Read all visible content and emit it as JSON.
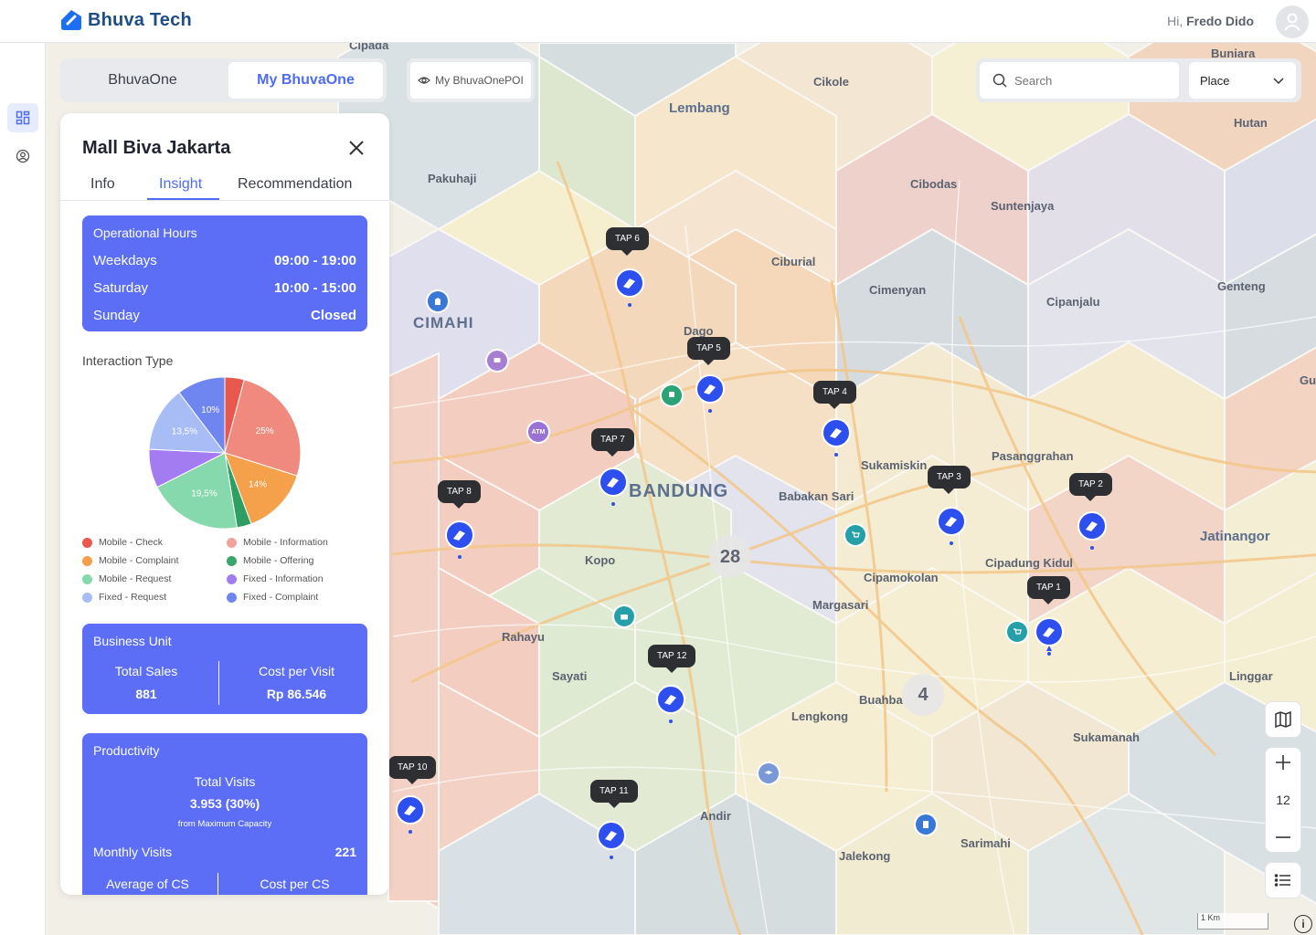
{
  "app": {
    "brand": "Bhuva Tech",
    "greeting_prefix": "Hi,",
    "user_name": "Fredo Dido"
  },
  "toggle": {
    "option_a": "BhuvaOne",
    "option_b": "My BhuvaOne",
    "active": "My BhuvaOne"
  },
  "poi_toggle": {
    "label": "My BhuvaOnePOI"
  },
  "search": {
    "placeholder": "Search",
    "value": "",
    "type_selected": "Place"
  },
  "panel": {
    "title": "Mall Biva Jakarta",
    "tabs": [
      "Info",
      "Insight",
      "Recommendation"
    ],
    "active_tab": "Insight",
    "hours": {
      "title": "Operational Hours",
      "rows": [
        {
          "day": "Weekdays",
          "time": "09:00 - 19:00"
        },
        {
          "day": "Saturday",
          "time": "10:00 - 15:00"
        },
        {
          "day": "Sunday",
          "time": "Closed"
        }
      ]
    },
    "interaction": {
      "title": "Interaction Type",
      "legend": [
        "Mobile - Check",
        "Mobile - Information",
        "Mobile - Complaint",
        "Mobile - Offering",
        "Mobile - Request",
        "Fixed - Information",
        "Fixed - Request",
        "Fixed - Complaint"
      ],
      "legend_colors": [
        "#e8584d",
        "#f0a39d",
        "#f5a04a",
        "#3aa56c",
        "#86d8ad",
        "#a27cf0",
        "#a8bdf6",
        "#6f86f0"
      ]
    },
    "business_unit": {
      "title": "Business Unit",
      "total_sales_label": "Total Sales",
      "total_sales": "881",
      "cost_per_visit_label": "Cost per Visit",
      "cost_per_visit": "Rp 86.546"
    },
    "productivity": {
      "title": "Productivity",
      "total_visits_label": "Total Visits",
      "total_visits": "3.953 (30%)",
      "capacity_note": "from Maximum Capacity",
      "monthly_visits_label": "Monthly Visits",
      "monthly_visits": "221",
      "avg_cs_label": "Average of CS",
      "cost_per_cs_label": "Cost per CS"
    }
  },
  "chart_data": {
    "type": "pie",
    "categories": [
      "Mobile - Check",
      "Mobile - Information",
      "Mobile - Complaint",
      "Mobile - Offering",
      "Mobile - Request",
      "Fixed - Information",
      "Fixed - Request",
      "Fixed - Complaint"
    ],
    "values": [
      4,
      25,
      14,
      3,
      19.5,
      8,
      13.5,
      10
    ],
    "printed_labels": [
      "",
      "25%",
      "14%",
      "",
      "19,5%",
      "",
      "13,5%",
      "10%"
    ],
    "colors": [
      "#e8584d",
      "#f0897e",
      "#f5a04a",
      "#2f9e62",
      "#86d8ad",
      "#a27cf0",
      "#a8bdf6",
      "#6f86f0"
    ]
  },
  "map": {
    "places": [
      "Cipada",
      "Cikole",
      "Buniara",
      "Lembang",
      "Hutan",
      "Pakuhaji",
      "Cibodas",
      "Suntenjaya",
      "Ciburial",
      "Cimenyan",
      "Genteng",
      "CIMAHI",
      "Cipanjalu",
      "Dago",
      "Sukamiskin",
      "Pasanggrahan",
      "BANDUNG",
      "Babakan Sari",
      "Jatinangor",
      "Kopo",
      "Cipadung Kidul",
      "Cipamokolan",
      "Margasari",
      "Rahayu",
      "Sayati",
      "Linggar",
      "Buahba",
      "Lengkong",
      "Sukamanah",
      "Andir",
      "Sarimahi",
      "Jalekong",
      "Gu"
    ],
    "taps": [
      "TAP 1",
      "TAP 2",
      "TAP 3",
      "TAP 4",
      "TAP 5",
      "TAP 6",
      "TAP 7",
      "TAP 8",
      "TAP 10",
      "TAP 11",
      "TAP 12"
    ],
    "clusters": [
      "28",
      "4"
    ],
    "poi_atm": "ATM",
    "zoom_level": "12",
    "scale": "1 Km",
    "info": "i"
  }
}
